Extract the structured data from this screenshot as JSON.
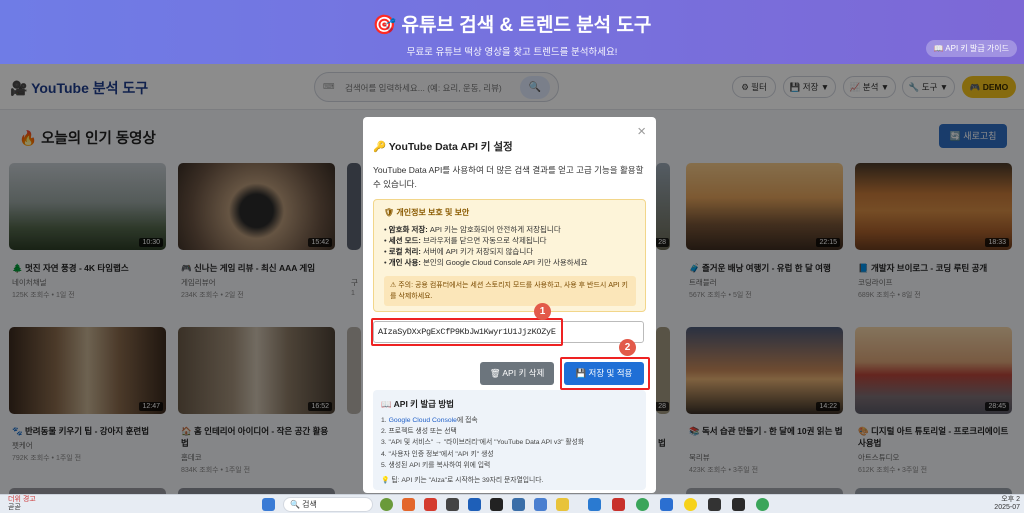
{
  "banner": {
    "title": "🎯 유튜브 검색 & 트렌드 분석 도구",
    "subtitle": "무료로 유튜브 떡상 영상을 찾고 트렌드를 분석하세요!",
    "guide_button": "📖 API 키 발급 가이드"
  },
  "navbar": {
    "logo": "🎥 YouTube 분석 도구",
    "search_placeholder": "검색어를 입력하세요... (예: 요리, 운동, 리뷰)",
    "keyboard_icon": "⌨",
    "search_button": "🔍",
    "filter": "⚙ 필터",
    "save": "💾 저장 ▼",
    "analysis": "📈 분석 ▼",
    "tools": "🔧 도구 ▼",
    "demo": "🎮 DEMO"
  },
  "section": {
    "title": "🔥 오늘의 인기 동영상",
    "refresh": "🔄 새로고침"
  },
  "videos": [
    {
      "title": "🌲 멋진 자연 풍경 - 4K 타임랩스",
      "channel": "네이처채널",
      "meta": "125K 조회수 • 1일 전",
      "duration": "10:30"
    },
    {
      "title": "🎮 신나는 게임 리뷰 - 최신 AAA 게임",
      "channel": "게임리뷰어",
      "meta": "234K 조회수 • 2일 전",
      "duration": "15:42"
    },
    {
      "title": "🧳 즐거운 배낭 여행기 - 유럽 한 달 여행",
      "channel": "트래블러",
      "meta": "567K 조회수 • 5일 전",
      "duration": "22:15"
    },
    {
      "title": "📘 개발자 브이로그 - 코딩 루틴 공개",
      "channel": "코딩라이프",
      "meta": "689K 조회수 • 8일 전",
      "duration": "18:33"
    },
    {
      "title": "🐾 반려동물 키우기 팁 - 강아지 훈련법",
      "channel": "펫케어",
      "meta": "792K 조회수 • 1주일 전",
      "duration": "12:47"
    },
    {
      "title": "🏠 홈 인테리어 아이디어 - 작은 공간 활용법",
      "channel": "홈데코",
      "meta": "834K 조회수 • 1주일 전",
      "duration": "16:52"
    },
    {
      "title": "📚 독서 습관 만들기 - 한 달에 10권 읽는 법",
      "channel": "북리뷰",
      "meta": "423K 조회수 • 3주일 전",
      "duration": "14:22"
    },
    {
      "title": "🎨 디지털 아트 튜토리얼 - 프로크리에이트 사용법",
      "channel": "아트스튜디오",
      "meta": "612K 조회수 • 3주일 전",
      "duration": "28:45"
    }
  ],
  "partial_texts": {
    "c3": "구",
    "c3b": "1",
    "dur3": "28",
    "dur7": "28",
    "t7": "법"
  },
  "modal": {
    "close": "×",
    "title": "🔑 YouTube Data API 키 설정",
    "desc": "YouTube Data API를 사용하여 더 많은 검색 결과를 얻고 고급 기능을 활용할 수 있습니다.",
    "privacy_title": "🛡 개인정보 보호 및 보안",
    "privacy_items": [
      {
        "b": "암호화 저장:",
        "t": " API 키는 암호화되어 안전하게 저장됩니다"
      },
      {
        "b": "세션 모드:",
        "t": " 브라우저를 닫으면 자동으로 삭제됩니다"
      },
      {
        "b": "로컬 처리:",
        "t": " 서버에 API 키가 저장되지 않습니다"
      },
      {
        "b": "개인 사용:",
        "t": " 본인의 Google Cloud Console API 키만 사용하세요"
      }
    ],
    "note": "⚠ 주의: 공용 컴퓨터에서는 세션 스토리지 모드를 사용하고, 사용 후 반드시 API 키를 삭제하세요.",
    "api_key_value": "AIzaSyDXxPgExCfP9KbJw1Kwyr1U1JjzKOZyE",
    "delete_button": "🗑 API 키 삭제",
    "save_button": "💾 저장 및 적용",
    "badge1": "1",
    "badge2": "2",
    "howto_title": "📖 API 키 발급 방법",
    "howto_steps": [
      {
        "pre": "1. ",
        "link": "Google Cloud Console",
        "post": "에 접속"
      },
      {
        "pre": "2. 프로젝트 생성 또는 선택",
        "link": "",
        "post": ""
      },
      {
        "pre": "3. \"API 및 서비스\" → \"라이브러리\"에서 \"YouTube Data API v3\" 활성화",
        "link": "",
        "post": ""
      },
      {
        "pre": "4. \"사용자 인증 정보\"에서 \"API 키\" 생성",
        "link": "",
        "post": ""
      },
      {
        "pre": "5. 생성된 API 키를 복사하여 위에 입력",
        "link": "",
        "post": ""
      }
    ],
    "tip": "💡 팁: API 키는 \"AIza\"로 시작하는 39자리 문자열입니다."
  },
  "taskbar": {
    "weather_line1": "더위 경고",
    "weather_line2": "곧곧",
    "search": "🔍 검색",
    "clock_line1": "오후 2",
    "clock_line2": "2025-07"
  }
}
